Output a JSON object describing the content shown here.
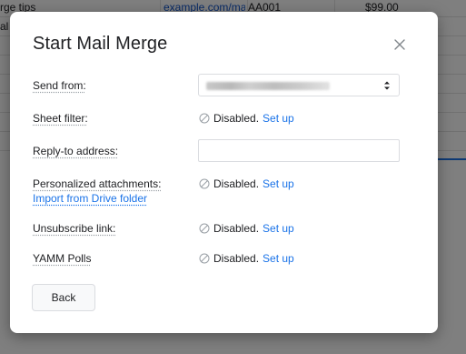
{
  "sheet": {
    "rows": [
      {
        "col_a": "rge tips",
        "col_b": "example.com/ma",
        "col_c": "AA001",
        "col_d": "$99.00"
      },
      {
        "col_a": "al",
        "col_b": "",
        "col_c": "",
        "col_d": ""
      }
    ]
  },
  "dialog": {
    "title": "Start Mail Merge",
    "close_icon": "close-icon",
    "send_from": {
      "label": "Send from:"
    },
    "sheet_filter": {
      "label": "Sheet filter:",
      "status": "Disabled.",
      "action": "Set up"
    },
    "reply_to": {
      "label": "Reply-to address:",
      "value": "",
      "placeholder": ""
    },
    "personalized_attachments": {
      "label": "Personalized attachments:",
      "link": "Import from Drive folder",
      "status": "Disabled.",
      "action": "Set up"
    },
    "unsubscribe_link": {
      "label": "Unsubscribe link:",
      "status": "Disabled.",
      "action": "Set up"
    },
    "yamm_polls": {
      "label": "YAMM Polls",
      "status": "Disabled.",
      "action": "Set up"
    },
    "back_label": "Back"
  },
  "colors": {
    "link": "#1a73e8",
    "text": "#202124",
    "overlay": "rgba(0,0,0,0.5)",
    "border": "#dadce0"
  }
}
